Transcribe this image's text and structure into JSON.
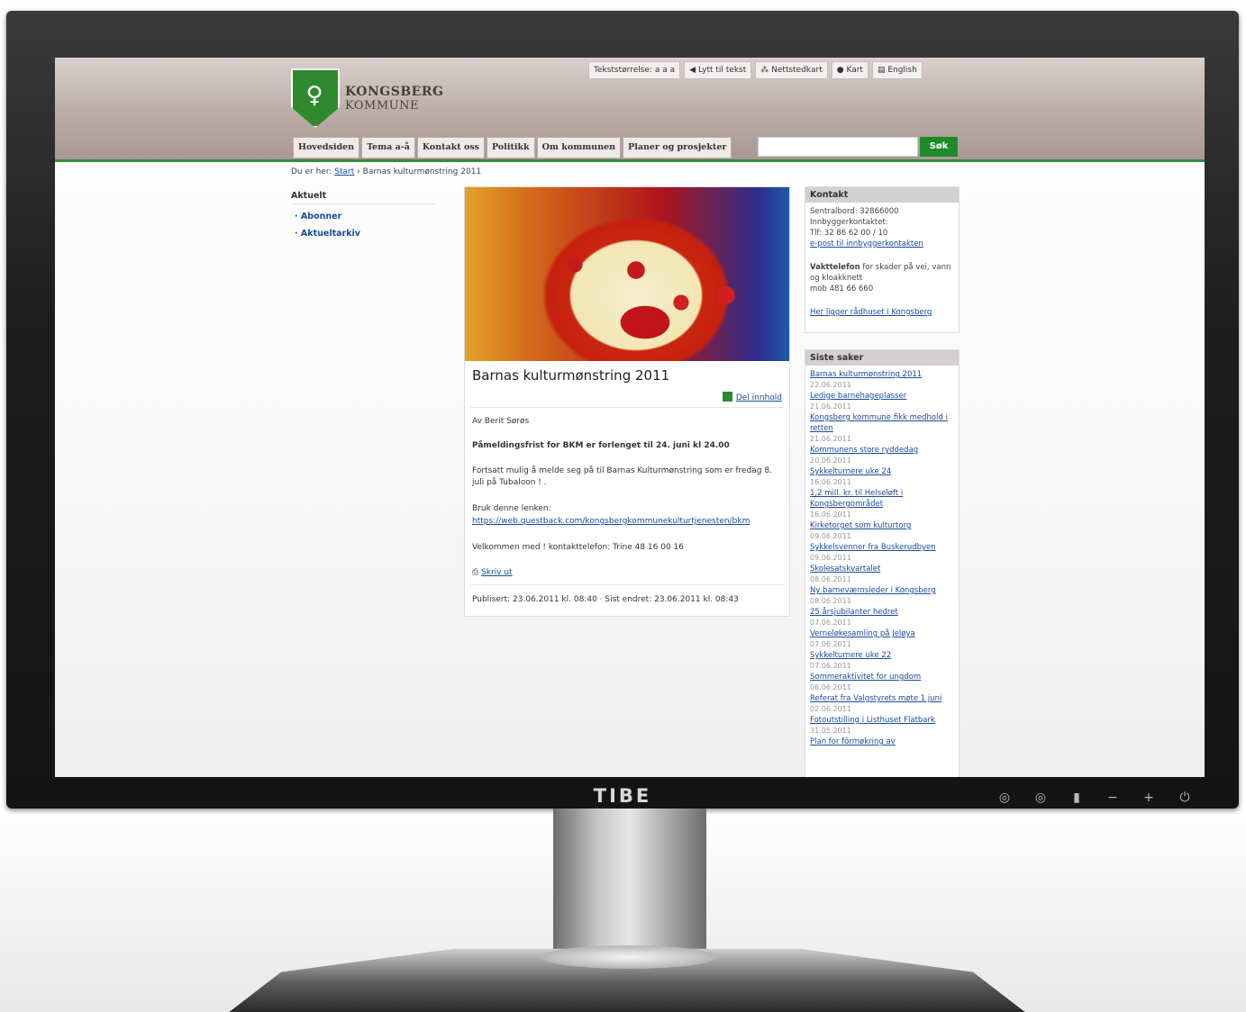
{
  "monitor": {
    "brand": "TIBE"
  },
  "site": {
    "logo_line1": "KONGSBERG",
    "logo_line2": "KOMMUNE",
    "tools": [
      "Tekststørrelse: a a a",
      "Lytt til tekst",
      "Nettstedkart",
      "Kart",
      "English"
    ],
    "nav": [
      "Hovedsiden",
      "Tema a-å",
      "Kontakt oss",
      "Politikk",
      "Om kommunen",
      "Planer og prosjekter"
    ],
    "search_button": "Søk",
    "breadcrumb": {
      "prefix": "Du er her:",
      "start": "Start",
      "current": "Barnas kulturmønstring 2011"
    },
    "left": {
      "heading": "Aktuelt",
      "links": [
        "Abonner",
        "Aktueltarkiv"
      ]
    },
    "article": {
      "title": "Barnas kulturmønstring 2011",
      "share": "Del innhold",
      "author": "Av Berit Sørøs",
      "lead": "Påmeldingsfrist for BKM er forlenget til 24. juni kl 24.00",
      "p1": "Fortsatt mulig å melde seg på til Barnas Kulturmønstring som er fredag 8. juli på Tubaloon ! .",
      "p2": "Bruk denne lenken:",
      "link": "https://web.questback.com/kongsbergkommunekulturtjenesten/bkm",
      "p3": "Velkommen med ! kontakttelefon: Trine 48 16 00 16",
      "print": "Skriv ut",
      "meta": "Publisert: 23.06.2011 kl. 08:40 · Sist endret: 23.06.2011 kl. 08:43"
    },
    "contact": {
      "heading": "Kontakt",
      "lines": [
        "Sentralbord: 32866000",
        "Innbyggerkontaktet:",
        "Tlf: 32 86 62 00 / 10"
      ],
      "email_link": "e-post til innbyggerkontakten",
      "vakt_bold": "Vakttelefon",
      "vakt_rest": "for skader på vei, vann og kloakknett",
      "vakt_phone": "mob 481 66 660",
      "map_link": "Her ligger rådhuset i Kongsberg"
    },
    "news": {
      "heading": "Siste saker",
      "items": [
        {
          "title": "Barnas kulturmønstring 2011",
          "date": "22.06.2011"
        },
        {
          "title": "Ledige barnehageplasser",
          "date": "21.06.2011"
        },
        {
          "title": "Kongsberg kommune fikk medhold i retten",
          "date": "21.06.2011"
        },
        {
          "title": "Kommunens store ryddedag",
          "date": "20.06.2011"
        },
        {
          "title": "Sykkelturnere uke 24",
          "date": "16.06.2011"
        },
        {
          "title": "1,2 mill. kr. til Helseløft i Kongsbergområdet",
          "date": "16.06.2011"
        },
        {
          "title": "Kirketorget som kulturtorg",
          "date": "09.06.2011"
        },
        {
          "title": "Sykkelsvenner fra Buskerudbyen",
          "date": "09.06.2011"
        },
        {
          "title": "Skolesatskvartalet",
          "date": "08.06.2011"
        },
        {
          "title": "Ny barneværnsleder i Kongsberg",
          "date": "08.06.2011"
        },
        {
          "title": "25 årsjubilanter hedret",
          "date": "07.06.2011"
        },
        {
          "title": "Verneløkesamling på Jeløya",
          "date": "07.06.2011"
        },
        {
          "title": "Sykkelturnere uke 22",
          "date": "07.06.2011"
        },
        {
          "title": "Sommeraktivitet for ungdom",
          "date": "06.06.2011"
        },
        {
          "title": "Referat fra Valgstyrets møte 1 juni",
          "date": "02.06.2011"
        },
        {
          "title": "Fotoutstilling i Listhuset Flatbark",
          "date": "31.05.2011"
        },
        {
          "title": "Plan for fôrmøkring av",
          "date": ""
        }
      ]
    }
  }
}
